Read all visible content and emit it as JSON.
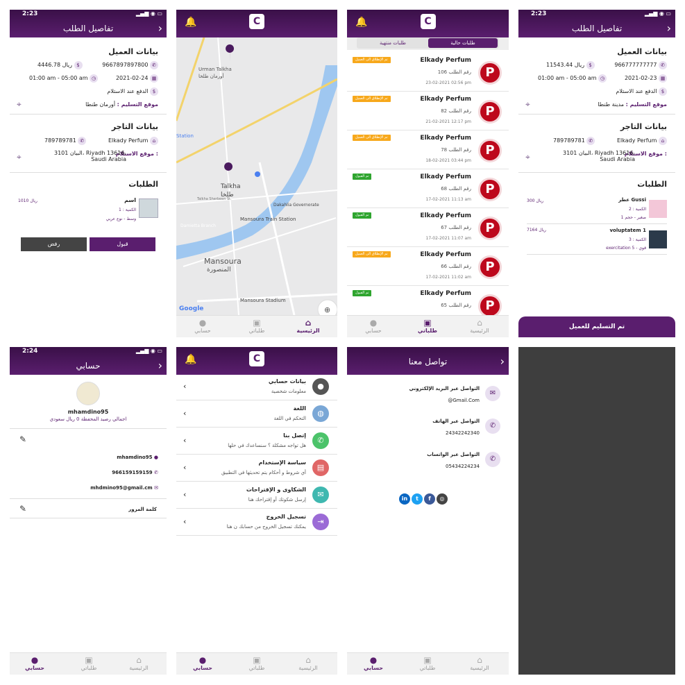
{
  "status_time_1": "2:23",
  "status_time_2": "2:24",
  "currency": "ريال",
  "order_details": {
    "title": "تفاصيل الطلب",
    "client_section": "بيانات العميل",
    "amount": "4446.78",
    "phone": "9667897897800",
    "date": "2021-02-24",
    "time_range": "01:00 am - 05:00 am",
    "payment": "الدفع عند الاستلام",
    "delivery_label": "موقع التسليم :",
    "delivery_value": "أورمان طنطا",
    "merchant_section": "بيانات التاجر",
    "merchant_name": "Elkady Perfum",
    "merchant_phone": "789789781",
    "pickup_label": "موقع الاستلام :",
    "pickup_value_1": "3101 البيان، Riyadh 13616،",
    "pickup_value_2": "Saudi Arabia",
    "orders_section": "الطلبات",
    "item_name": "اسم",
    "item_qty": "الكمية : 1",
    "item_meta": "وسط - نوع عربي",
    "item_price": "1010",
    "accept_btn": "قبول",
    "reject_btn": "رفض"
  },
  "map": {
    "labels": [
      "Urman Talkha",
      "أورمان طلخا",
      "Talkha",
      "طلخا",
      "Dakahlia Governorate",
      "Mansoura Train Station",
      "Mansoura",
      "المنصورة",
      "Mansoura Stadium",
      "Station",
      "Google",
      "Talkha Sherbeen St.",
      "Damietta Branch"
    ]
  },
  "orders_list": {
    "tab_current": "طلبات حالية",
    "tab_finished": "طلبات منتهية",
    "badge_transit": "تم الإنطلاق الى العميل",
    "badge_accepted": "تم القبول",
    "items": [
      {
        "store": "Elkady Perfum",
        "num": "رقم الطلب 106",
        "date": "23-02-2021 02:56 pm",
        "status": "transit"
      },
      {
        "store": "Elkady Perfum",
        "num": "رقم الطلب 82",
        "date": "21-02-2021 12:17 pm",
        "status": "transit"
      },
      {
        "store": "Elkady Perfum",
        "num": "رقم الطلب 78",
        "date": "18-02-2021 03:44 pm",
        "status": "transit"
      },
      {
        "store": "Elkady Perfum",
        "num": "رقم الطلب 68",
        "date": "17-02-2021 11:13 am",
        "status": "accepted"
      },
      {
        "store": "Elkady Perfum",
        "num": "رقم الطلب 67",
        "date": "17-02-2021 11:07 am",
        "status": "accepted"
      },
      {
        "store": "Elkady Perfum",
        "num": "رقم الطلب 66",
        "date": "17-02-2021 11:02 am",
        "status": "transit"
      },
      {
        "store": "Elkady Perfum",
        "num": "رقم الطلب 65",
        "date": "",
        "status": "accepted"
      }
    ]
  },
  "order_details_2": {
    "title": "تفاصيل الطلب",
    "client_section": "بيانات العميل",
    "amount": "11543.44",
    "phone": "966777777777",
    "date": "2021-02-23",
    "time_range": "01:00 am - 05:00 am",
    "payment": "الدفع عند الاستلام",
    "delivery_label": "موقع التسليم :",
    "delivery_value": "مدينة طنطا",
    "merchant_section": "بيانات التاجر",
    "merchant_name": "Elkady Perfum",
    "merchant_phone": "789789781",
    "pickup_label": "موقع الاستلام :",
    "pickup_value_1": "3101 البيان، Riyadh 13616،",
    "pickup_value_2": "Saudi Arabia",
    "orders_section": "الطلبات",
    "item1_name": "عطر Gussi",
    "item1_qty": "الكمية : 2",
    "item1_meta": "صغير - حجم 1",
    "item1_price": "300",
    "item2_name": "voluptatem 1",
    "item2_qty": "الكمية : 3",
    "item2_meta": "exercitation 5 - قوي",
    "item2_price": "7164",
    "deliver_btn": "تم التسليم للعميل"
  },
  "account": {
    "title": "حسابي",
    "username": "mhamdino95",
    "balance": "اجمالي رصيد المحفظة 0 ريال سعودي",
    "field_user": "mhamdino95",
    "field_phone": "966159159159",
    "field_email": "mhdmino95@gmail.cm",
    "password_label": "كلمة المرور"
  },
  "menu": {
    "items": [
      {
        "title": "بيانات حسابي",
        "sub": "معلومات شخصية",
        "icon": "person-icon",
        "color": "#555555"
      },
      {
        "title": "اللغة",
        "sub": "التحكم في اللغة",
        "icon": "globe-icon",
        "color": "#7aa7d6"
      },
      {
        "title": "إتصل بنا",
        "sub": "هل تواجه مشكلة ؟ سنساعدك في حلها",
        "icon": "phone-icon",
        "color": "#4cc36a"
      },
      {
        "title": "سياسة الإستخدام",
        "sub": "أي شروط و أحكام يتم تحديثها في التطبيق",
        "icon": "document-icon",
        "color": "#e06666"
      },
      {
        "title": "الشكاوى و الإقتراحات",
        "sub": "إرسل شكوتك أو إقتراحك هنا",
        "icon": "feedback-icon",
        "color": "#3fb8b0"
      },
      {
        "title": "تسجيل الخروج",
        "sub": "يمكنك تسجيل الخروج من حسابك ن هنا",
        "icon": "logout-icon",
        "color": "#9b6bd6"
      }
    ]
  },
  "contact": {
    "title": "تواصل معنا",
    "email_title": "التواصل عبر البريد الإلكتروني",
    "email_value": "@Gmail.Com",
    "phone_title": "التواصل عبر الهاتف",
    "phone_value": "24342242340",
    "whatsapp_title": "التواصل عبر الواتساب",
    "whatsapp_value": "05434224234"
  },
  "tabs": {
    "home": "الرئيسية",
    "orders": "طلباتي",
    "account": "حسابي"
  }
}
